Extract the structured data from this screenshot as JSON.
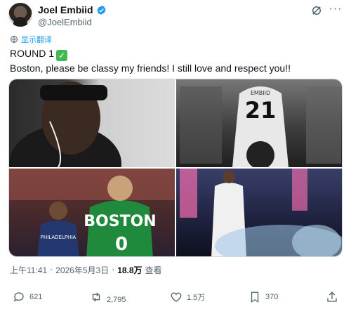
{
  "header": {
    "display_name": "Joel Embiid",
    "handle": "@JoelEmbiid",
    "verified_icon": "verified-badge-icon",
    "more_icon": "more-icon",
    "grok_icon": "grok-icon"
  },
  "translate": {
    "label": "显示翻译",
    "icon": "globe-translate-icon"
  },
  "tweet": {
    "line1": "ROUND 1",
    "line1_emoji": "✓",
    "line2": "Boston, please be classy my friends! I still love and respect you!!"
  },
  "media": {
    "photo2_jersey_name": "EMBIID",
    "photo2_jersey_number": "21",
    "photo3_jersey_name": "BOSTON",
    "photo3_jersey_number": "0",
    "photo3_shirt_text": "PHILADELPHIA"
  },
  "meta": {
    "time": "上午11:41",
    "separator": "·",
    "date": "2026年5月3日",
    "views": "18.8万",
    "views_label": "查看"
  },
  "actions": {
    "reply_count": "621",
    "retweet_count": "2,795",
    "like_count": "1.5万",
    "bookmark_count": "370"
  },
  "colors": {
    "accent": "#1d9bf0",
    "text": "#0f1419",
    "muted": "#536471"
  }
}
